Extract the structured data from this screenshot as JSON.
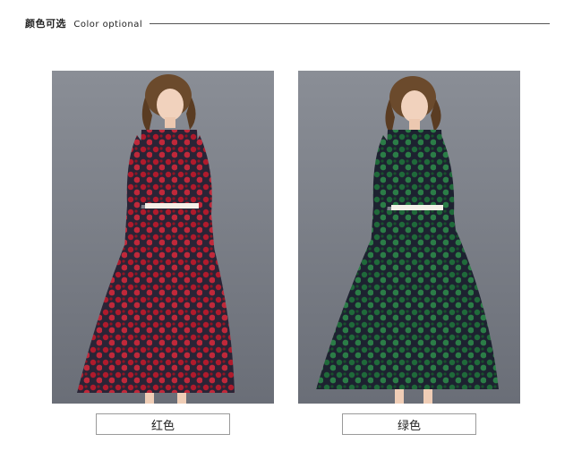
{
  "header": {
    "title_cn": "颜色可选",
    "title_en": "Color optional"
  },
  "variants": [
    {
      "label": "红色",
      "color": "#b01a2c",
      "lace_dark": "#2a2436"
    },
    {
      "label": "绿色",
      "color": "#1f6a3a",
      "lace_dark": "#1d2230"
    }
  ],
  "colors": {
    "photo_bg": "#7a7f88",
    "rule": "#555555",
    "box_border": "#9a9a9a"
  }
}
